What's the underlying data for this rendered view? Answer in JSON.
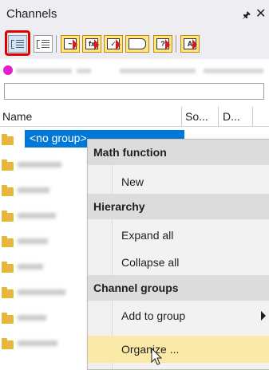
{
  "panel": {
    "title": "Channels",
    "pin_icon": "pin-icon",
    "close_icon": "close-icon"
  },
  "toolbar": {
    "buttons": [
      {
        "name": "tree-view-icon",
        "selected": true
      },
      {
        "name": "list-view-icon",
        "selected": false
      },
      {
        "name": "channel-wave-icon",
        "glyph": "~"
      },
      {
        "name": "formula-icon",
        "glyph": "fx"
      },
      {
        "name": "filter-check-icon",
        "glyph": "✓"
      },
      {
        "name": "tag-icon",
        "glyph": ""
      },
      {
        "name": "help-icon",
        "glyph": "?"
      },
      {
        "name": "export-icon",
        "glyph": "A"
      }
    ],
    "highlight_color": "#e00000"
  },
  "table": {
    "columns": [
      "Name",
      "So...",
      "D..."
    ],
    "rows": [
      {
        "label": "<no group>",
        "selected": true
      }
    ]
  },
  "context_menu": {
    "sections": [
      {
        "header": "Math function",
        "items": [
          "New"
        ]
      },
      {
        "header": "Hierarchy",
        "items": [
          "Expand all",
          "Collapse all"
        ]
      },
      {
        "header": "Channel groups",
        "items": [
          "Add to group",
          "Organize ..."
        ]
      }
    ],
    "hover_item": "Organize ...",
    "hover_color": "#fbe9a7"
  },
  "colors": {
    "selection": "#0078d7",
    "panel_bg": "#eeeef2",
    "folder": "#e5b73b"
  }
}
